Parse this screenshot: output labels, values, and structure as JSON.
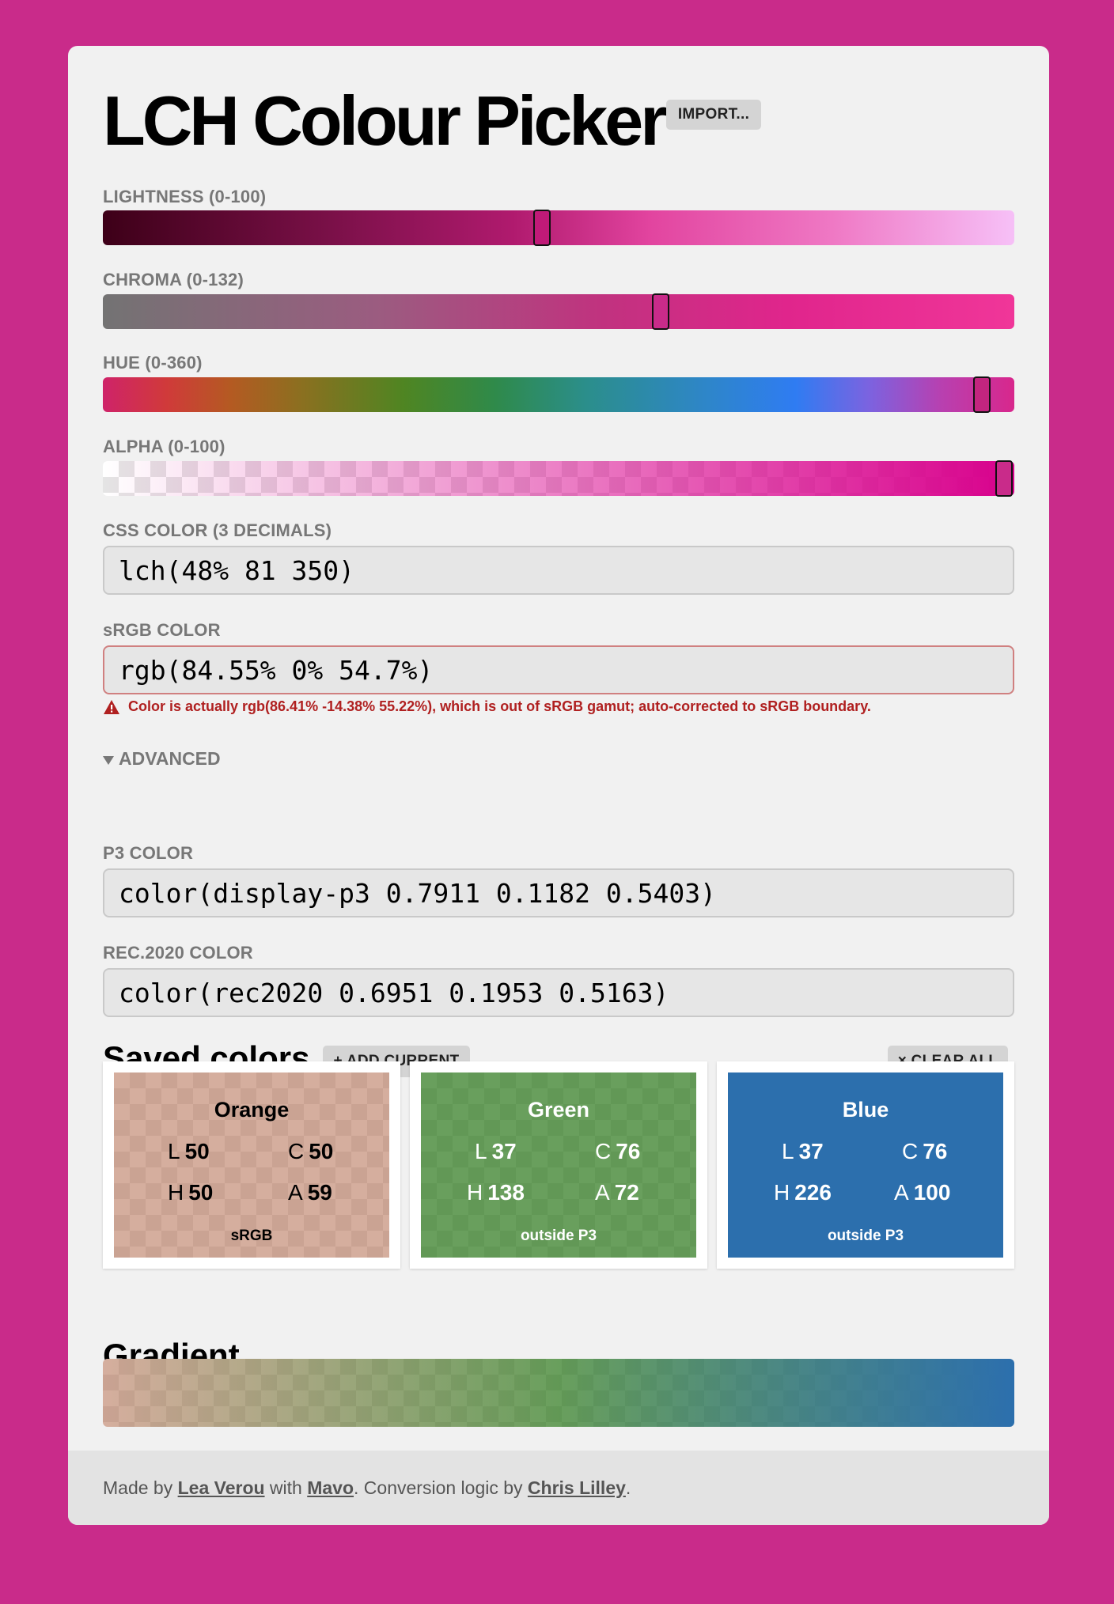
{
  "header": {
    "title": "LCH Colour Picker",
    "import_label": "IMPORT..."
  },
  "sliders": {
    "lightness": {
      "label": "LIGHTNESS (0-100)",
      "value": 48
    },
    "chroma": {
      "label": "CHROMA (0-132)",
      "value": 81
    },
    "hue": {
      "label": "HUE (0-360)",
      "value": 350
    },
    "alpha": {
      "label": "ALPHA (0-100)",
      "value": 100
    }
  },
  "css_color": {
    "label": "CSS COLOR (3 DECIMALS)",
    "value": "lch(48% 81 350)"
  },
  "srgb_color": {
    "label": "sRGB COLOR",
    "value": "rgb(84.55% 0% 54.7%)",
    "warning": "Color is actually rgb(86.41% -14.38% 55.22%), which is out of sRGB gamut; auto-corrected to sRGB boundary."
  },
  "advanced": {
    "toggle_label": "ADVANCED",
    "p3": {
      "label": "P3 COLOR",
      "value": "color(display-p3 0.7911 0.1182 0.5403)"
    },
    "rec2020": {
      "label": "REC.2020 COLOR",
      "value": "color(rec2020 0.6951 0.1953 0.5163)"
    }
  },
  "saved": {
    "title": "Saved colors",
    "add_label": "+ ADD CURRENT",
    "clear_label": "× CLEAR ALL",
    "colors": [
      {
        "name": "Orange",
        "l": "50",
        "c": "50",
        "h": "50",
        "a": "59",
        "gamut": "sRGB",
        "color": "#b8755a",
        "text_color": "#000000"
      },
      {
        "name": "Green",
        "l": "37",
        "c": "76",
        "h": "138",
        "a": "72",
        "gamut": "outside P3",
        "color": "#2f7a1e",
        "text_color": "#ffffff"
      },
      {
        "name": "Blue",
        "l": "37",
        "c": "76",
        "h": "226",
        "a": "100",
        "gamut": "outside P3",
        "color": "#2c6fad",
        "text_color": "#ffffff"
      }
    ]
  },
  "gradient": {
    "title": "Gradient"
  },
  "footer": {
    "made_by": "Made by ",
    "author": "Lea Verou",
    "with": " with ",
    "tool": "Mavo",
    "conversion": ". Conversion logic by ",
    "contributor": "Chris Lilley",
    "end": "."
  },
  "colors": {
    "page_background": "#c92b8a",
    "current": "#d8008c",
    "error": "#b02020"
  },
  "icons": {
    "warning": "warning-icon",
    "advanced_toggle": "triangle-down-icon"
  }
}
